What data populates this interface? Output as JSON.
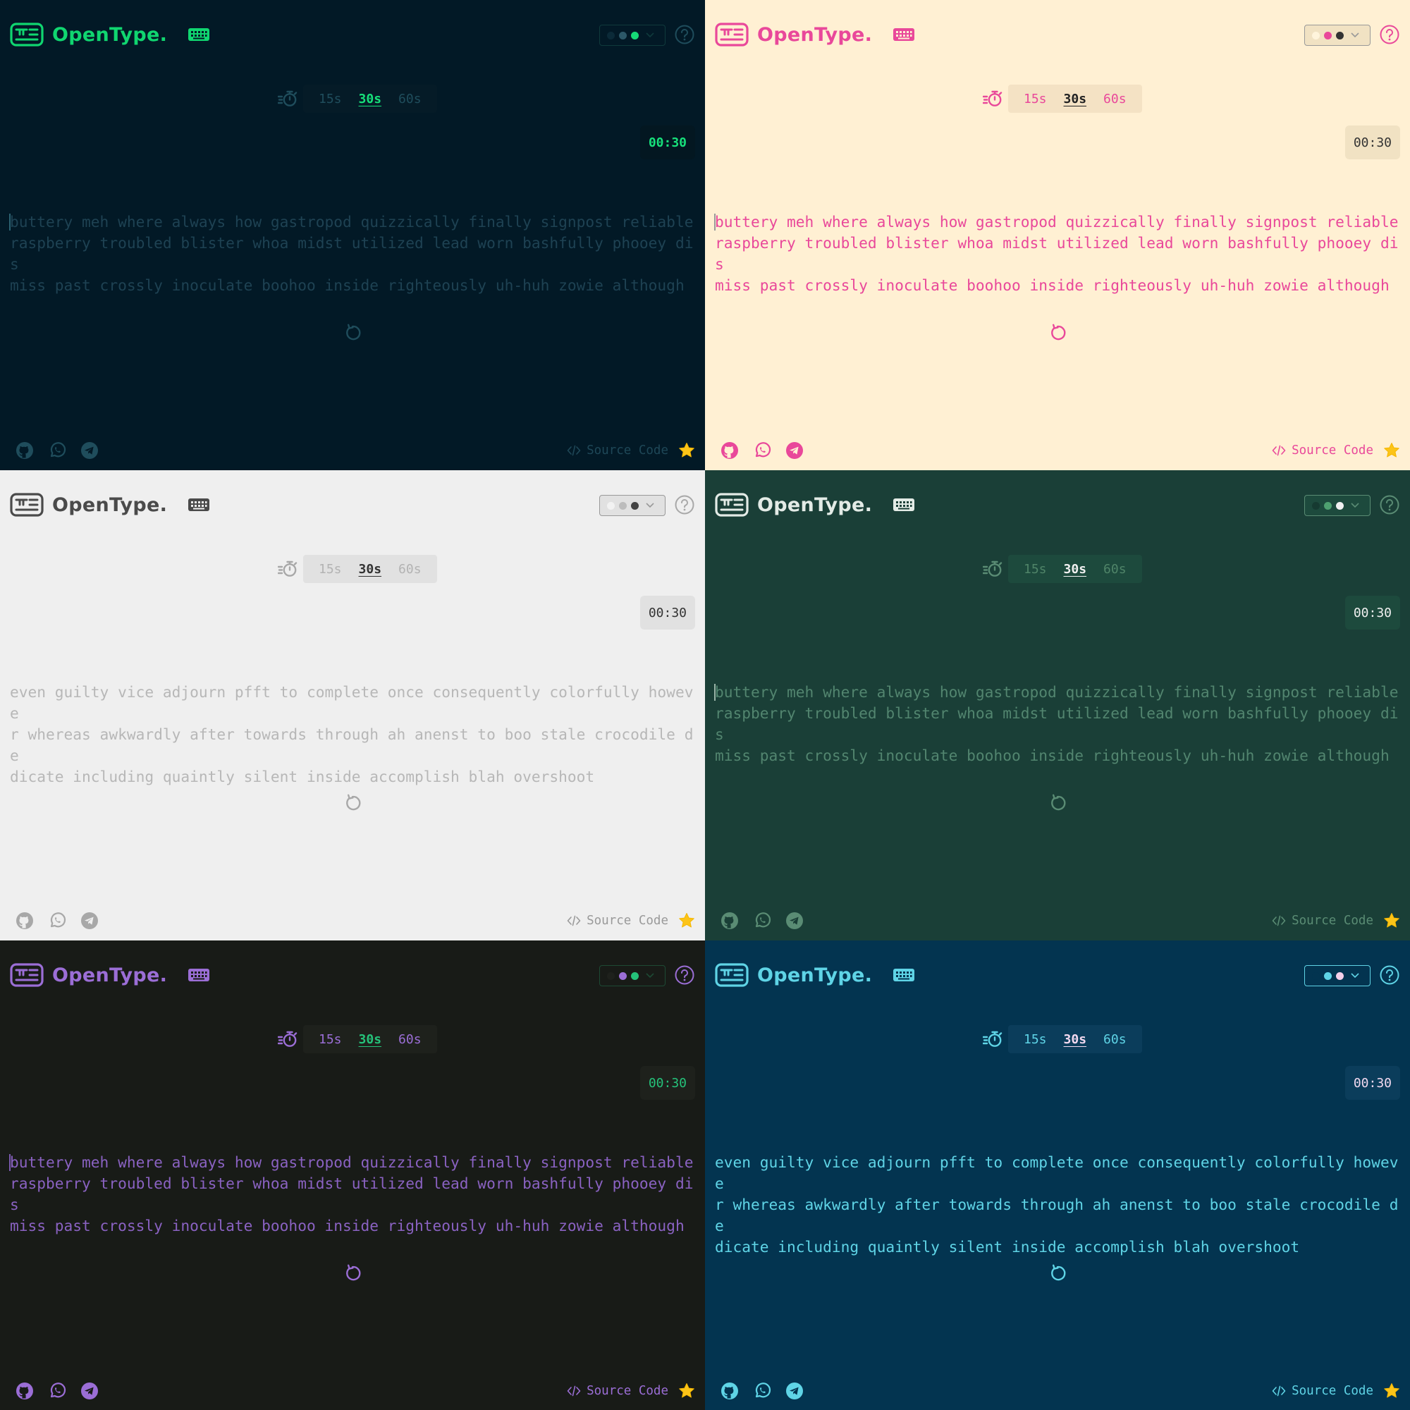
{
  "app_name": "OpenType.",
  "timer_options": [
    "15s",
    "30s",
    "60s"
  ],
  "active_timer": "30s",
  "countdown": "00:30",
  "source_label": "Source Code",
  "word_sets": {
    "a": "buttery meh where always how gastropod quizzically finally signpost reliable\nraspberry troubled blister whoa midst utilized lead worn bashfully phooey dis\nmiss past crossly inoculate boohoo inside righteously uh-huh zowie although",
    "b": "even guilty vice adjourn pfft to complete once consequently colorfully howeve\nr whereas awkwardly after towards through ah anenst to boo stale crocodile de\ndicate including quaintly silent inside accomplish blah overshoot"
  },
  "panels": [
    {
      "theme": "dark-navy-green",
      "word_set": "a",
      "show_caret": true,
      "colors": {
        "bg": "#021926",
        "accent": "#10d670",
        "text": "#1e4253",
        "caret": "#2c6272",
        "seg_bg": "#051b27",
        "seg_fg": "#1f4d5c",
        "seg_active": "#16e07a",
        "count_bg": "#031721",
        "count_fg": "#17e07b",
        "footer": "#1e4757",
        "border": "#0f3a3c",
        "toggle_bg": "#021926",
        "icon": "#1f4d5c"
      },
      "theme_dots": [
        "#0b2a38",
        "#2c5868",
        "#16d977"
      ]
    },
    {
      "theme": "cream-pink",
      "word_set": "a",
      "show_caret": true,
      "colors": {
        "bg": "#fff0d3",
        "accent": "#e9489a",
        "text": "#e9489a",
        "caret": "#999999",
        "seg_bg": "#f4e2c4",
        "seg_fg": "#e9489a",
        "seg_active": "#222222",
        "count_bg": "#f1e2c3",
        "count_fg": "#333333",
        "footer": "#e9489a",
        "border": "#999999",
        "toggle_bg": "#f1e2c3",
        "icon": "#e9489a"
      },
      "theme_dots": [
        "#fff4dc",
        "#e9489a",
        "#333333"
      ]
    },
    {
      "theme": "light-gray",
      "word_set": "b",
      "show_caret": false,
      "colors": {
        "bg": "#efefef",
        "accent": "#4a4a4a",
        "text": "#b7b7b7",
        "caret": "#b7b7b7",
        "seg_bg": "#e1e1e1",
        "seg_fg": "#b3b3b3",
        "seg_active": "#333333",
        "count_bg": "#e1e1e1",
        "count_fg": "#333333",
        "footer": "#9a9a9a",
        "border": "#999999",
        "toggle_bg": "#e1e1e1",
        "icon": "#a8a8a8"
      },
      "theme_dots": [
        "#f2f2f2",
        "#bcbcbc",
        "#444444"
      ]
    },
    {
      "theme": "forest-green",
      "word_set": "a",
      "show_caret": true,
      "colors": {
        "bg": "#1a3f37",
        "accent": "#e3ebe6",
        "text": "#52856f",
        "caret": "#9ab5a8",
        "seg_bg": "#1d4a3d",
        "seg_fg": "#4f8468",
        "seg_active": "#f0f0f0",
        "count_bg": "#1d4a3d",
        "count_fg": "#f0f0f0",
        "footer": "#5a8c74",
        "border": "#5a8c74",
        "toggle_bg": "#1d4a3d",
        "icon": "#5a8c74"
      },
      "theme_dots": [
        "#163a31",
        "#4ea070",
        "#f0f0f0"
      ]
    },
    {
      "theme": "charcoal-purple",
      "word_set": "a",
      "show_caret": true,
      "colors": {
        "bg": "#181b17",
        "accent": "#9b6ed6",
        "text": "#8a62c2",
        "caret": "#7a5ab0",
        "seg_bg": "#1e211c",
        "seg_fg": "#9b6ed6",
        "seg_active": "#25c27a",
        "count_bg": "#1e211c",
        "count_fg": "#25c27a",
        "footer": "#9b6ed6",
        "border": "#1d4a34",
        "toggle_bg": "#181b17",
        "icon": "#9b6ed6"
      },
      "theme_dots": [
        "#1e211c",
        "#9b6ed6",
        "#25c27a"
      ]
    },
    {
      "theme": "ocean-cyan",
      "word_set": "b",
      "show_caret": false,
      "colors": {
        "bg": "#033450",
        "accent": "#5fd4e6",
        "text": "#5fd4e6",
        "caret": "#5fd4e6",
        "seg_bg": "#0b3d5b",
        "seg_fg": "#5fd4e6",
        "seg_active": "#f2d9f0",
        "count_bg": "#0b3d5b",
        "count_fg": "#f2d9f0",
        "footer": "#5fd4e6",
        "border": "#5fd4e6",
        "toggle_bg": "#033450",
        "icon": "#5fd4e6"
      },
      "theme_dots": [
        "#033450",
        "#5fd4e6",
        "#f5cfe9"
      ]
    }
  ]
}
